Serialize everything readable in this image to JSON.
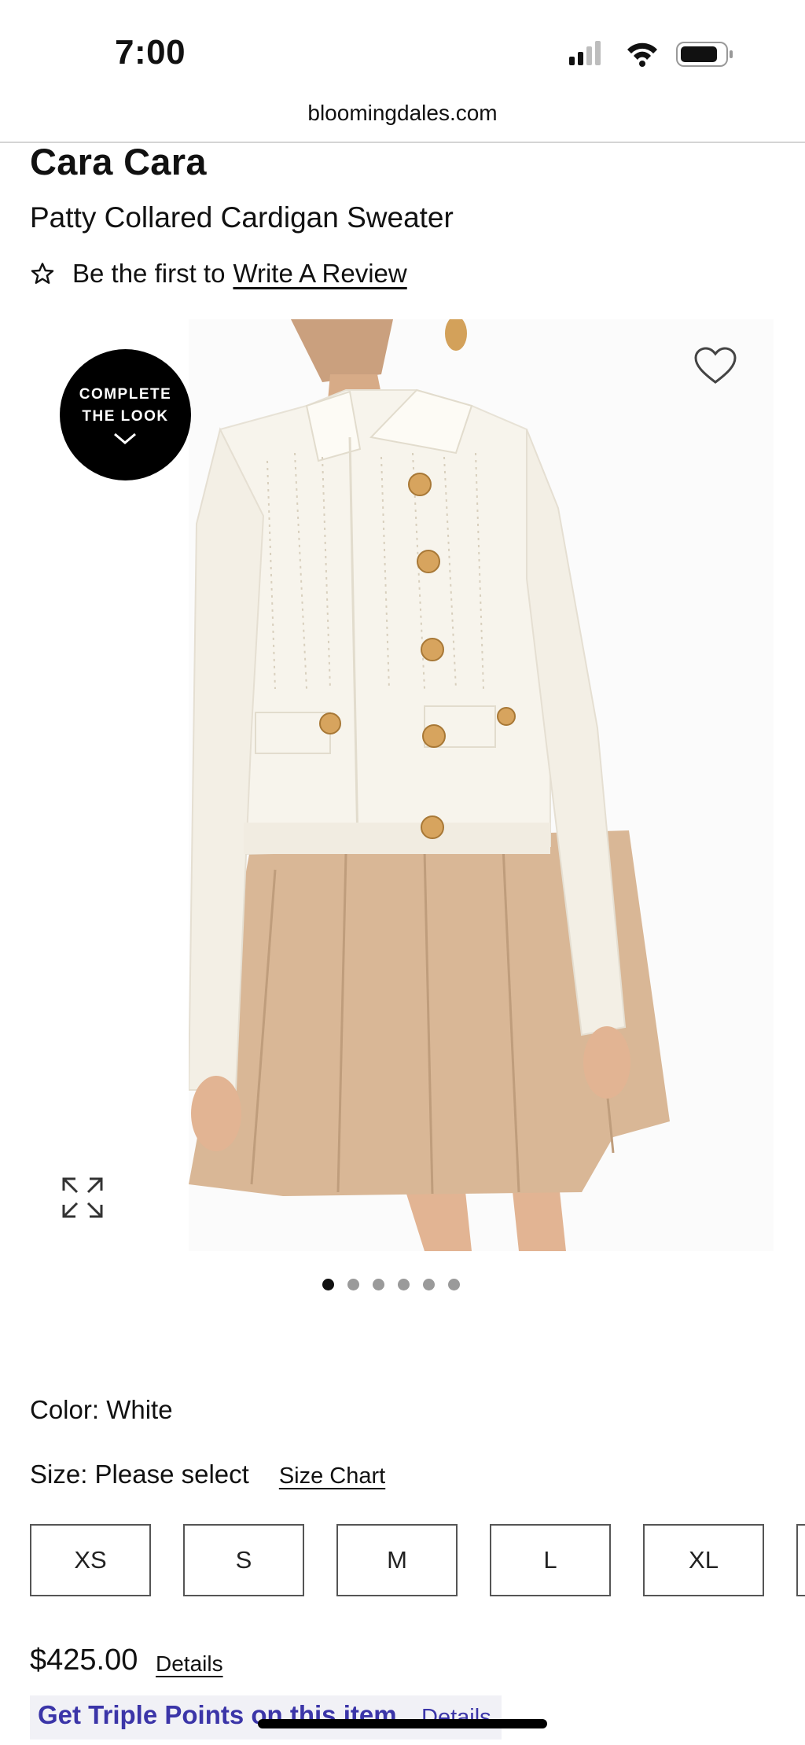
{
  "status_bar": {
    "time": "7:00"
  },
  "browser": {
    "url": "bloomingdales.com"
  },
  "product": {
    "brand": "Cara Cara",
    "name": "Patty Collared Cardigan Sweater",
    "review_prompt": "Be the first to",
    "review_link": "Write A Review",
    "complete_look_line1": "COMPLETE",
    "complete_look_line2": "THE LOOK",
    "image_count": 6,
    "active_image_index": 0,
    "color_label": "Color:",
    "color_value": "White",
    "size_label": "Size:",
    "size_value": "Please select",
    "size_chart": "Size Chart",
    "sizes": [
      "XS",
      "S",
      "M",
      "L",
      "XL"
    ],
    "price": "$425.00",
    "price_details": "Details",
    "promo_text": "Get Triple Points on this item",
    "promo_details": "Details"
  },
  "icons": [
    "star-outline-icon",
    "heart-outline-icon",
    "expand-icon",
    "chevron-down-icon",
    "signal-icon",
    "wifi-icon",
    "battery-icon"
  ],
  "colors": {
    "promo": "#3b35a8",
    "badge": "#000000",
    "skirt": "#d9b796",
    "cardigan": "#f7f4ec",
    "button_gold": "#d7a45e"
  }
}
